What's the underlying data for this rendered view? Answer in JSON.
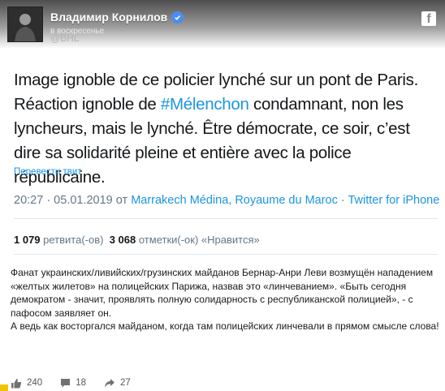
{
  "header": {
    "author": "Владимир Корнилов",
    "time": "в воскресенье",
    "ghost_handle": "@BHL"
  },
  "tweet": {
    "text_before_hashtag": "Image ignoble de ce policier lynché sur un pont de Paris. Réaction ignoble de ",
    "hashtag": "#Mélenchon",
    "text_after_hashtag": " condamnant, non les lyncheurs, mais le lynché. Être démocrate, ce soir, c’est dire sa solidarité pleine et entière avec la police républicaine.",
    "translate_label": "Перевести твит",
    "timestamp": "20:27 · 05.01.2019 от ",
    "location": "Marrakech Médina, Royaume du Maroc",
    "separator": " · ",
    "client": "Twitter for iPhone",
    "retweets_count": "1 079",
    "retweets_label": " ретвита(-ов)  ",
    "likes_count": "3 068",
    "likes_label": " отметки(-ок) «Нравится»"
  },
  "post": {
    "paragraph_1": "Фанат украинских/ливийских/грузинских майданов Бернар-Анри Леви возмущён нападением «желтых жилетов» на полицейских Парижа, назвав это «линчеванием». «Быть сегодня демократом - значит, проявлять полную солидарность с республиканской полицией», - с пафосом заявляет он.",
    "paragraph_2": "А ведь как восторгался майданом, когда там полицейских линчевали в прямом смысле слова!"
  },
  "footer": {
    "likes": "240",
    "comments": "18",
    "shares": "27"
  },
  "colors": {
    "link": "#1b95e0",
    "verified": "#4a8df7",
    "header_dark": "#4e4e4e"
  },
  "icons": [
    "facebook-icon",
    "verified-icon",
    "like-icon",
    "comment-icon",
    "share-icon"
  ]
}
